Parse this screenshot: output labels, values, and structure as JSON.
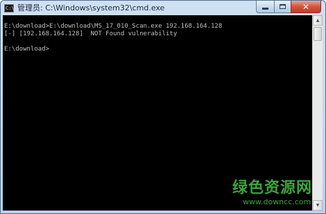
{
  "window": {
    "title": "管理员: C:\\Windows\\system32\\cmd.exe",
    "icon": "cmd-console-icon",
    "icon_text": "C:\\",
    "controls": {
      "minimize_icon": "minimize-icon",
      "maximize_icon": "maximize-icon",
      "close_icon": "close-icon",
      "close_glyph": "✕"
    }
  },
  "console": {
    "background": "#000000",
    "text_color": "#c0c0c0",
    "lines": [
      "E:\\download>E:\\download\\MS_17_010_Scan.exe 192.168.164.128",
      "[-] [192.168.164.128]  NOT Found vulnerability",
      "",
      "E:\\download>"
    ]
  },
  "scrollbar": {
    "up_glyph": "▲",
    "down_glyph": "▼"
  },
  "watermark": {
    "text": "绿色资源网",
    "url": "www.downcc.com",
    "color": "#3aa63a"
  }
}
